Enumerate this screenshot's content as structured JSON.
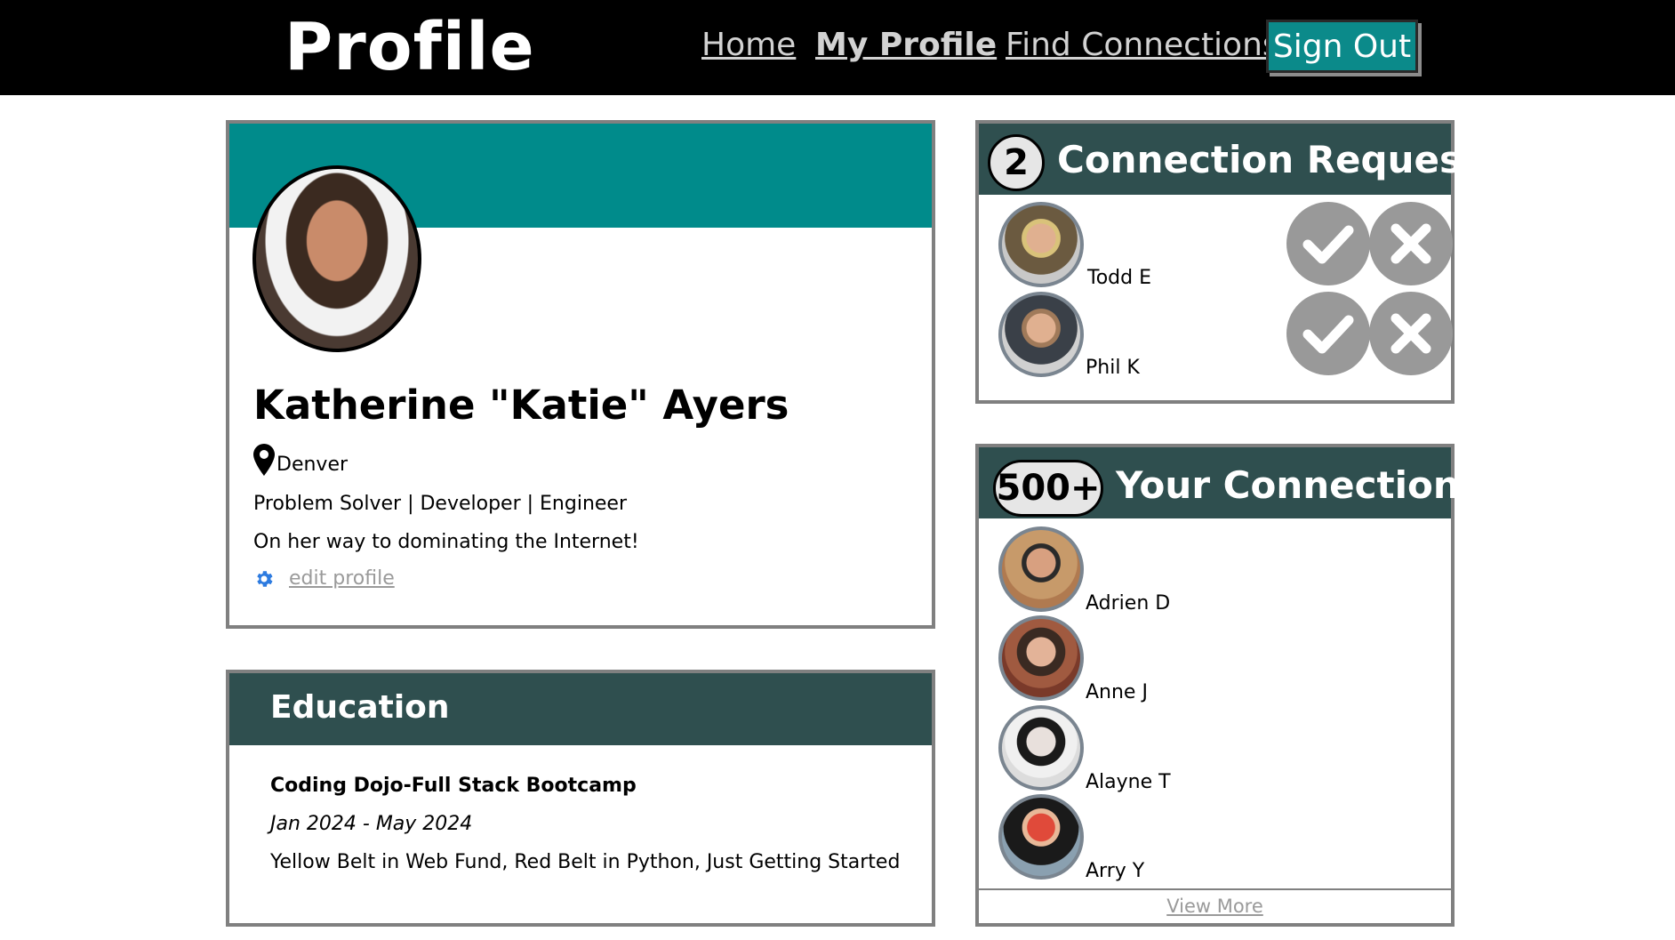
{
  "header": {
    "brand": "Profile",
    "nav": {
      "home": "Home",
      "my_profile": "My Profile",
      "find_connections": "Find Connections",
      "sign_out": "Sign Out"
    }
  },
  "profile": {
    "name": "Katherine \"Katie\" Ayers",
    "location": "Denver",
    "tagline": "Problem Solver | Developer | Engineer",
    "bio": "On her way to dominating the Internet!",
    "edit_label": "edit profile"
  },
  "education": {
    "title": "Education",
    "school": "Coding Dojo-Full Stack Bootcamp",
    "dates": "Jan 2024 - May 2024",
    "description": "Yellow Belt in Web Fund, Red Belt in Python, Just Getting Started"
  },
  "requests": {
    "count": "2",
    "title": "Connection Requests",
    "items": [
      {
        "name": "Todd E"
      },
      {
        "name": "Phil K"
      }
    ]
  },
  "connections": {
    "count": "500+",
    "title": "Your Connections",
    "items": [
      {
        "name": "Adrien D"
      },
      {
        "name": "Anne J"
      },
      {
        "name": "Alayne T"
      },
      {
        "name": "Arry Y"
      }
    ],
    "view_more": "View More"
  },
  "colors": {
    "banner": "#008b8b",
    "header_dark": "#2f4f4f",
    "action_grey": "#999999"
  },
  "icons": [
    "map-pin-icon",
    "gear-icon",
    "check-icon",
    "close-icon"
  ]
}
